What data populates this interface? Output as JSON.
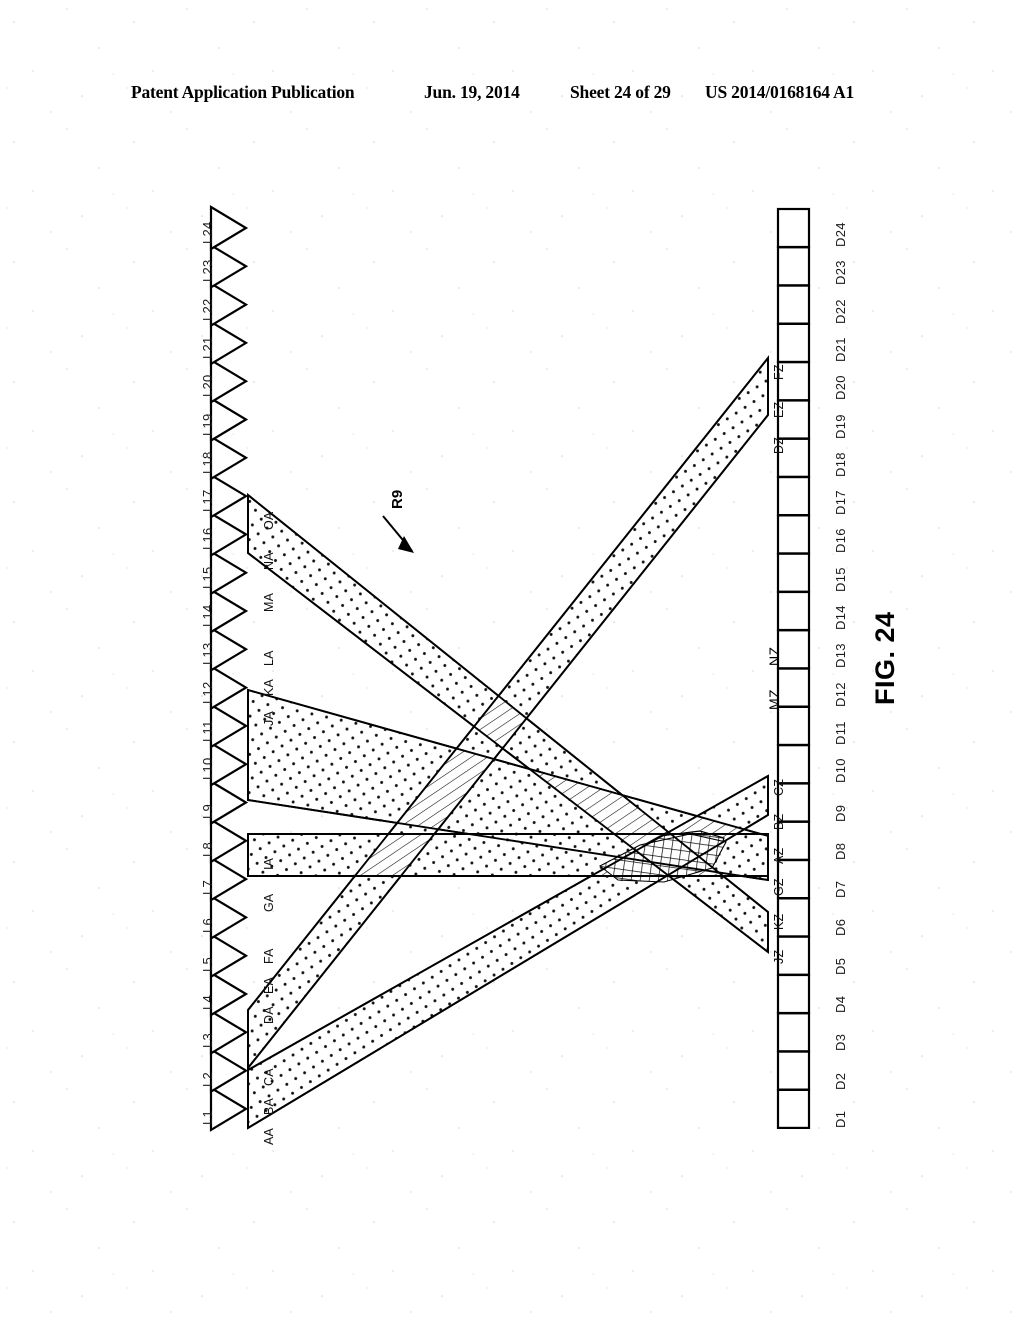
{
  "header": {
    "publication": "Patent Application Publication",
    "date": "Jun. 19, 2014",
    "sheet": "Sheet 24 of 29",
    "patent_number": "US 2014/0168164 A1"
  },
  "figure": {
    "caption": "FIG. 24",
    "reference_numeral": "R9"
  },
  "left_axis": {
    "name": "light-source-array",
    "symbol": "triangle",
    "labels": [
      "L1",
      "L2",
      "L3",
      "L4",
      "L5",
      "L6",
      "L7",
      "L8",
      "L9",
      "L10",
      "L11",
      "L12",
      "L13",
      "L14",
      "L15",
      "L16",
      "L17",
      "L18",
      "L19",
      "L20",
      "L21",
      "L22",
      "L23",
      "L24"
    ]
  },
  "right_axis": {
    "name": "detector-array",
    "symbol": "square",
    "labels": [
      "D1",
      "D2",
      "D3",
      "D4",
      "D5",
      "D6",
      "D7",
      "D8",
      "D9",
      "D10",
      "D11",
      "D12",
      "D13",
      "D14",
      "D15",
      "D16",
      "D17",
      "D18",
      "D19",
      "D20",
      "D21",
      "D22",
      "D23",
      "D24"
    ]
  },
  "source_port_labels": [
    "AA",
    "BA",
    "CA",
    "DA",
    "EA",
    "FA",
    "GA",
    "IA",
    "JA",
    "KA",
    "LA",
    "MA",
    "NA",
    "OA"
  ],
  "detector_port_labels": [
    "JZ",
    "KZ",
    "GZ",
    "AZ",
    "BZ",
    "CZ",
    "MZ",
    "NZ",
    "DZ",
    "EZ",
    "FZ"
  ],
  "beams": [
    {
      "id": "beam-1",
      "source_span": "AA-CA",
      "target_span": "BZ-CZ",
      "fill": "dotted"
    },
    {
      "id": "beam-2",
      "source_span": "DA-FA",
      "target_span": "DZ-FZ",
      "fill": "dotted"
    },
    {
      "id": "beam-3",
      "source_span": "GA-IA",
      "target_span": "GZ-AZ",
      "fill": "dotted"
    },
    {
      "id": "beam-4",
      "source_span": "JA-LA",
      "target_span": "AZ-GZ",
      "fill": "dotted"
    },
    {
      "id": "beam-5",
      "source_span": "MA-OA",
      "target_span": "JZ-KZ",
      "fill": "dotted"
    }
  ],
  "overlap_regions": [
    {
      "id": "overlap-hatch-upper",
      "fill": "diagonal-hatch"
    },
    {
      "id": "overlap-hatch-mid",
      "fill": "diagonal-hatch"
    },
    {
      "id": "overlap-hatch-left",
      "fill": "diagonal-hatch"
    },
    {
      "id": "overlap-hatch-right",
      "fill": "diagonal-hatch"
    },
    {
      "id": "overlap-crosshatch-center",
      "fill": "cross-hatch"
    }
  ]
}
